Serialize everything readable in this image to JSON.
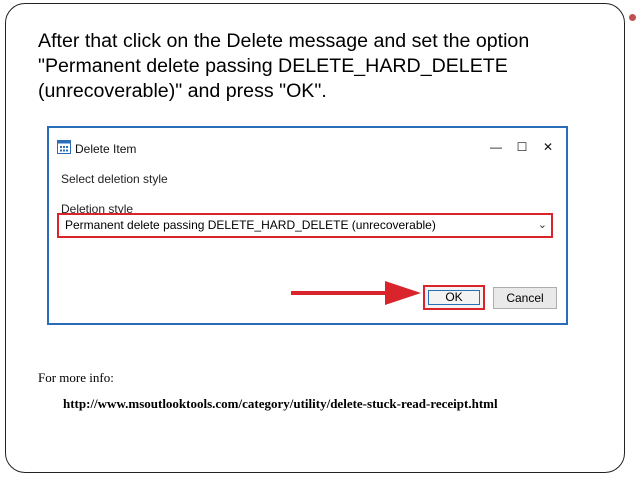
{
  "instruction": {
    "line1": "After that click on the Delete message and set the option",
    "line2": "\"Permanent delete passing DELETE_HARD_DELETE",
    "line3": "(unrecoverable)\" and press \"OK\"."
  },
  "dialog": {
    "title": "Delete Item",
    "icon": "app-grid-icon",
    "window_controls": [
      "minimize-icon",
      "maximize-icon",
      "close-icon"
    ],
    "select_label": "Select deletion style",
    "deletion_style_label": "Deletion style",
    "selected_option": "Permanent delete passing DELETE_HARD_DELETE (unrecoverable)",
    "ok_label": "OK",
    "cancel_label": "Cancel"
  },
  "footer": {
    "more_info": "For more info:",
    "link": "http://www.msoutlooktools.com/category/utility/delete-stuck-read-receipt.html"
  },
  "colors": {
    "highlight_red": "#d9242b",
    "frame_blue": "#2b6cb8",
    "bullet": "#c0504d"
  }
}
